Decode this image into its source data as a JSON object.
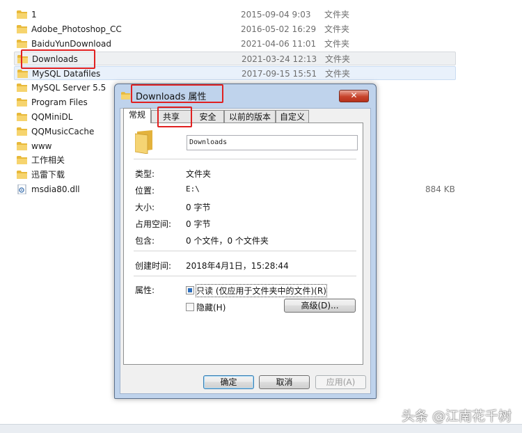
{
  "files": [
    {
      "name": "1",
      "date": "2015-09-04 9:03",
      "type": "文件夹",
      "size": "",
      "icon": "folder-icon"
    },
    {
      "name": "Adobe_Photoshop_CC",
      "date": "2016-05-02 16:29",
      "type": "文件夹",
      "size": "",
      "icon": "folder-icon"
    },
    {
      "name": "BaiduYunDownload",
      "date": "2021-04-06 11:01",
      "type": "文件夹",
      "size": "",
      "icon": "folder-icon"
    },
    {
      "name": "Downloads",
      "date": "2021-03-24 12:13",
      "type": "文件夹",
      "size": "",
      "icon": "folder-icon"
    },
    {
      "name": "MySQL Datafiles",
      "date": "2017-09-15 15:51",
      "type": "文件夹",
      "size": "",
      "icon": "folder-icon"
    },
    {
      "name": "MySQL Server 5.5",
      "date": "",
      "type": "",
      "size": "",
      "icon": "folder-icon"
    },
    {
      "name": "Program Files",
      "date": "",
      "type": "",
      "size": "",
      "icon": "folder-icon"
    },
    {
      "name": "QQMiniDL",
      "date": "",
      "type": "",
      "size": "",
      "icon": "folder-icon"
    },
    {
      "name": "QQMusicCache",
      "date": "",
      "type": "",
      "size": "",
      "icon": "folder-icon"
    },
    {
      "name": "www",
      "date": "",
      "type": "",
      "size": "",
      "icon": "folder-icon"
    },
    {
      "name": "工作相关",
      "date": "",
      "type": "",
      "size": "",
      "icon": "folder-icon"
    },
    {
      "name": "迅雷下载",
      "date": "",
      "type": "",
      "size": "",
      "icon": "folder-icon"
    },
    {
      "name": "msdia80.dll",
      "date": "",
      "type": "",
      "size": "884 KB",
      "icon": "dll-file-icon"
    }
  ],
  "dialog": {
    "title": "Downloads 属性",
    "close_label": "✕",
    "tabs": [
      "常规",
      "共享",
      "安全",
      "以前的版本",
      "自定义"
    ],
    "active_tab": "常规",
    "folder_name": "Downloads",
    "props": [
      {
        "label": "类型:",
        "value": "文件夹"
      },
      {
        "label": "位置:",
        "value": "E:\\"
      },
      {
        "label": "大小:",
        "value": "0 字节"
      },
      {
        "label": "占用空间:",
        "value": "0 字节"
      },
      {
        "label": "包含:",
        "value": "0 个文件，0 个文件夹"
      }
    ],
    "created": {
      "label": "创建时间:",
      "value": "2018年4月1日，15:28:44"
    },
    "attributes": {
      "label": "属性:",
      "readonly_label": "只读 (仅应用于文件夹中的文件)(R)",
      "readonly_state": "indeterminate",
      "hidden_label": "隐藏(H)",
      "hidden_checked": false,
      "advanced_button": "高级(D)..."
    },
    "buttons": {
      "ok": "确定",
      "cancel": "取消",
      "apply": "应用(A)"
    }
  },
  "watermark": "头条 @江南花千树",
  "colors": {
    "annotation_red": "#e02020",
    "dialog_frame": "#bfd3ec",
    "selected_row": "#eef0f2",
    "hover_row": "#e9f1fb"
  }
}
